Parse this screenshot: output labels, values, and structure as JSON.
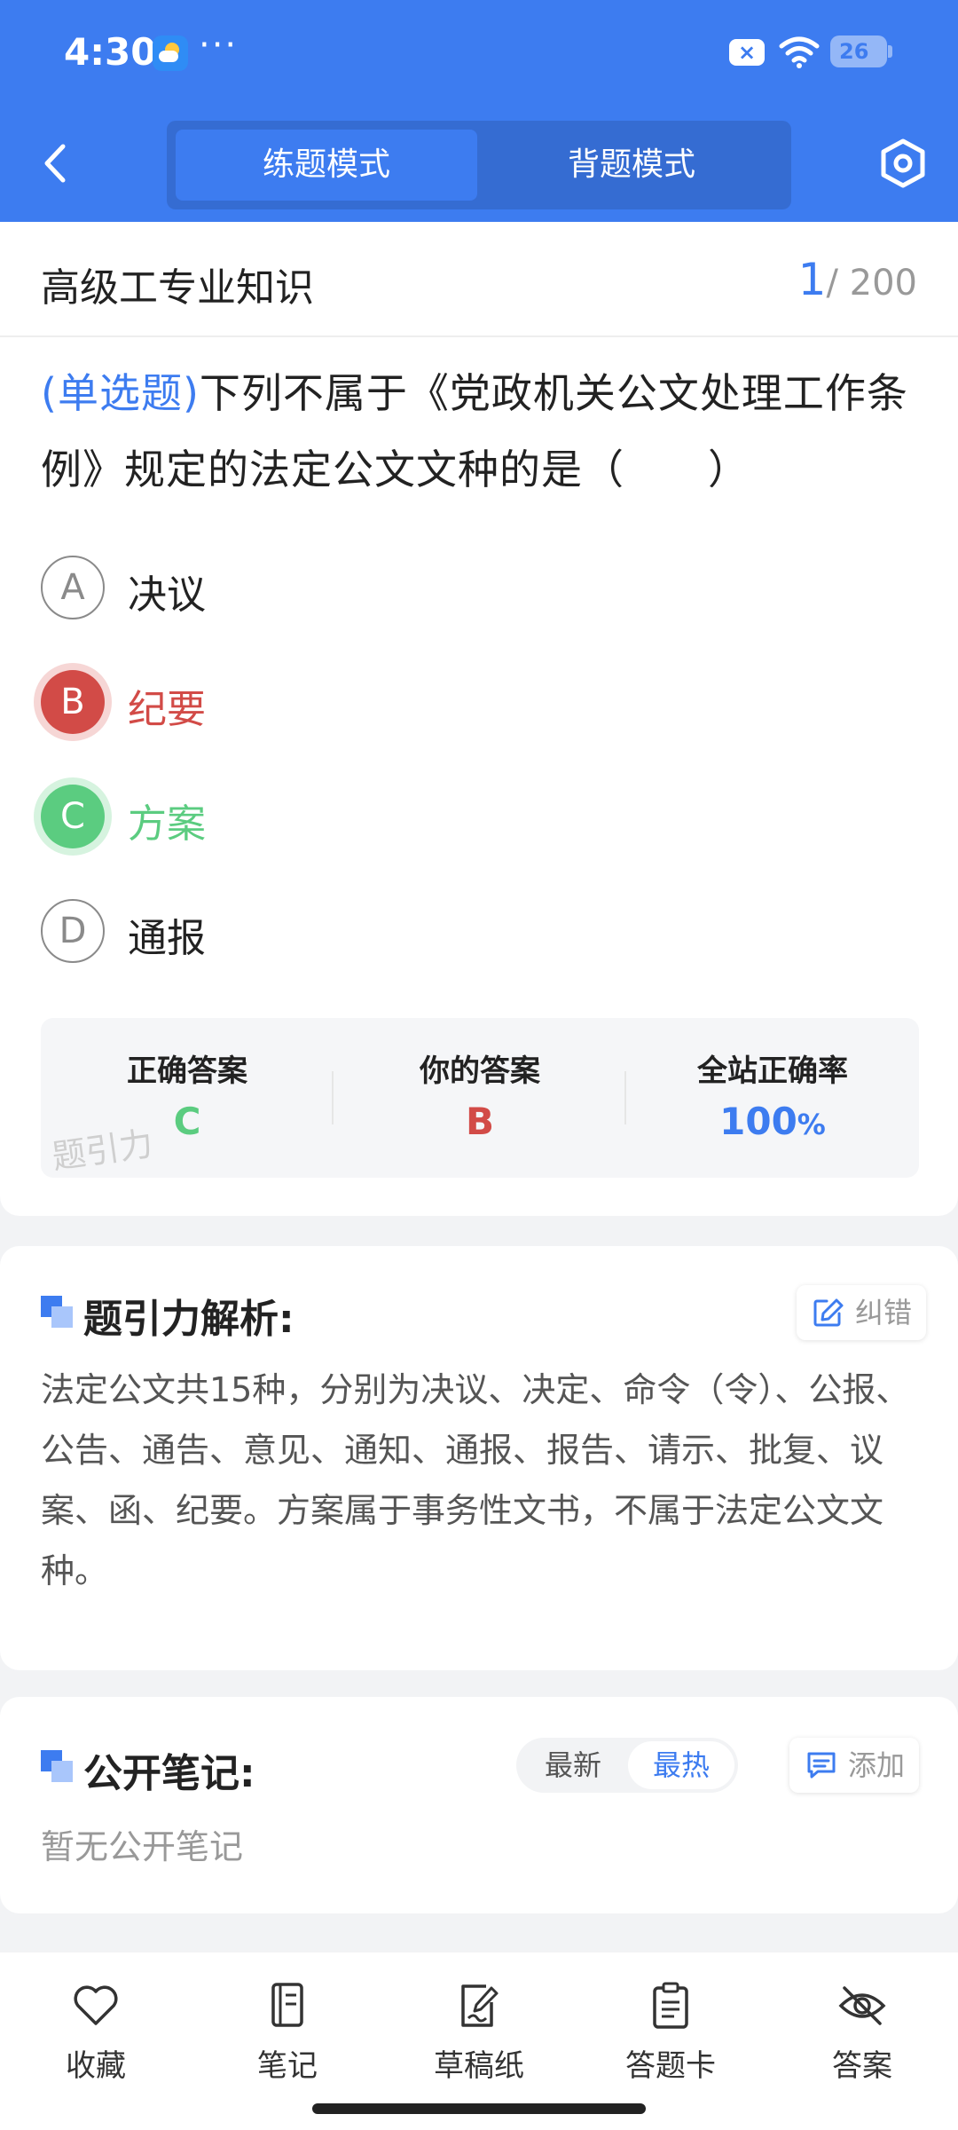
{
  "status": {
    "time": "4:30",
    "dots": "···",
    "battery": "26"
  },
  "nav": {
    "mode_practice": "练题模式",
    "mode_recite": "背题模式"
  },
  "question": {
    "section": "高级工专业知识",
    "current": "1",
    "total": "/ 200",
    "type": "(单选题)",
    "text": "下列不属于《党政机关公文处理工作条例》规定的法定公文文种的是（　　）",
    "options": [
      {
        "letter": "A",
        "text": "决议"
      },
      {
        "letter": "B",
        "text": "纪要"
      },
      {
        "letter": "C",
        "text": "方案"
      },
      {
        "letter": "D",
        "text": "通报"
      }
    ]
  },
  "answers": {
    "correct_label": "正确答案",
    "correct_value": "C",
    "yours_label": "你的答案",
    "yours_value": "B",
    "rate_label": "全站正确率",
    "rate_value": "100",
    "rate_unit": "%",
    "watermark": "题引力"
  },
  "analysis": {
    "title": "题引力解析:",
    "report_label": "纠错",
    "text": "法定公文共15种，分别为决议、决定、命令（令）、公报、公告、通告、意见、通知、通报、报告、请示、批复、议案、函、纪要。方案属于事务性文书，不属于法定公文文种。"
  },
  "notes": {
    "title": "公开笔记:",
    "sort_newest": "最新",
    "sort_hottest": "最热",
    "add_label": "添加",
    "empty": "暂无公开笔记"
  },
  "bottom": {
    "favorite": "收藏",
    "note": "笔记",
    "draft": "草稿纸",
    "answer_card": "答题卡",
    "answer": "答案"
  },
  "colors": {
    "primary": "#3d7cf0",
    "wrong": "#d24b47",
    "right": "#5bcc80"
  }
}
